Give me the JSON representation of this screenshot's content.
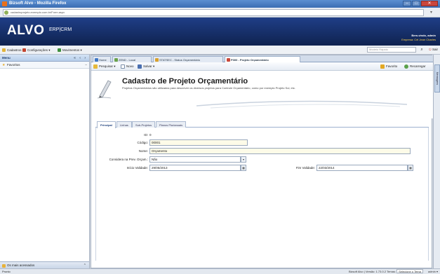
{
  "browser": {
    "window_title": "Bizsoft Alvo - Mozilla Firefox",
    "url": "cadastroprojeto.exemplo.com.br/Form.aspx"
  },
  "brand": {
    "logo": "ALVO",
    "suite": "ERP|CRM",
    "user_line": "Bem-vindo, admin",
    "company_line": "Empresa: Cel Jean Charles"
  },
  "menu": {
    "items": [
      {
        "label": "Cadastros ▾",
        "icon": "folder-icon"
      },
      {
        "label": "Configurações ▾",
        "icon": "tools-icon"
      },
      {
        "label": "Movimentos ▾",
        "icon": "arrow-icon"
      }
    ],
    "search_placeholder": "Modelo Rápido",
    "exit_label": "Sair"
  },
  "sidebar": {
    "title": "Menu",
    "favorites_label": "Favoritos",
    "bottom_label": "Os mais acessados"
  },
  "tabs": [
    {
      "label": "Home",
      "color": "#3f78c7"
    },
    {
      "label": "ZEND - Local",
      "color": "#6aa24a"
    },
    {
      "label": "STATSEC - Status Orçamentário",
      "color": "#d9a12b"
    },
    {
      "label": "P300 - Projeto Orçamentário",
      "color": "#c9473a"
    }
  ],
  "toolbar": {
    "pesquisar": "Pesquisar ▾",
    "novo": "Novo",
    "salvar": "Salvar ▾",
    "favorito": "Favorito",
    "recarregar": "Recarregar"
  },
  "form": {
    "title": "Cadastro de Projeto Orçamentário",
    "description": "Projetos Orçamentários são utilizados para descrever os diversos projetos para Controle Orçamentário, como por exemplo Projeto Sul, etc.",
    "tabs": [
      "Principal",
      "Linhas",
      "Sub-Projetos",
      "Planos Plurianuais"
    ],
    "fields": {
      "id_label": "ID:",
      "id_value": "0",
      "codigo_label": "Código:",
      "codigo_value": "00001",
      "nome_label": "Nome:",
      "nome_value": "Orçamento",
      "considera_label": "Considera na Prev. Orçam.:",
      "considera_value": "Não",
      "inicio_label": "Início Validade:",
      "inicio_value": "29/05/2013",
      "fim_label": "Fim Validade:",
      "fim_value": "22/03/2014"
    }
  },
  "right_rail": {
    "label": "Mensagens"
  },
  "status": {
    "left": "Pronto",
    "version": "Bizsoft Alvo | Versão: 1.73.0.2",
    "theme_label": "Temas:",
    "theme_value": "Selecione o Tema",
    "user": "admin ▾"
  }
}
